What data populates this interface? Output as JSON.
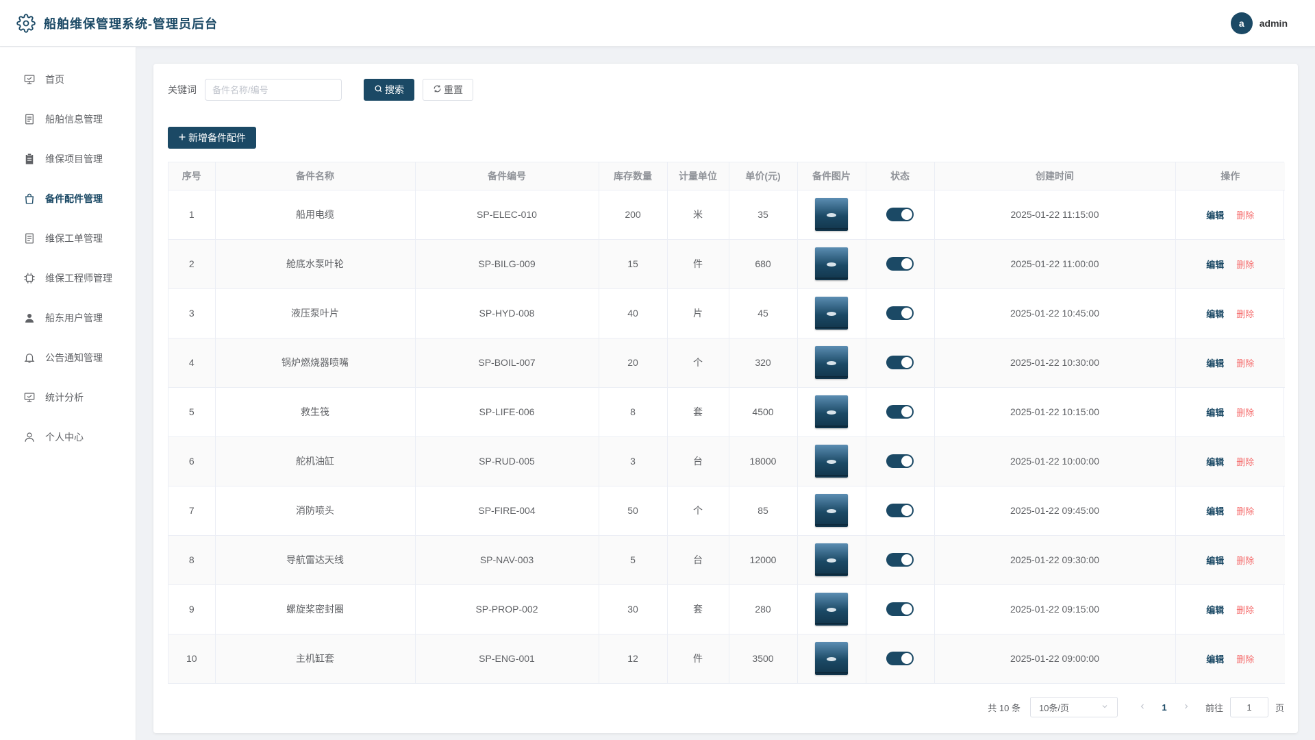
{
  "header": {
    "title": "船舶维保管理系统-管理员后台",
    "avatar_letter": "a",
    "username": "admin"
  },
  "sidebar": {
    "items": [
      {
        "label": "首页",
        "icon": "presentation-icon"
      },
      {
        "label": "船舶信息管理",
        "icon": "document-icon"
      },
      {
        "label": "维保项目管理",
        "icon": "clipboard-icon"
      },
      {
        "label": "备件配件管理",
        "icon": "bag-icon",
        "active": true
      },
      {
        "label": "维保工单管理",
        "icon": "document-icon"
      },
      {
        "label": "维保工程师管理",
        "icon": "cpu-icon"
      },
      {
        "label": "船东用户管理",
        "icon": "user-filled-icon"
      },
      {
        "label": "公告通知管理",
        "icon": "bell-icon"
      },
      {
        "label": "统计分析",
        "icon": "presentation-icon"
      },
      {
        "label": "个人中心",
        "icon": "user-outline-icon"
      }
    ]
  },
  "search": {
    "label": "关键词",
    "placeholder": "备件名称/编号",
    "value": "",
    "search_label": "搜索",
    "reset_label": "重置"
  },
  "add_label": "新增备件配件",
  "table": {
    "headers": [
      "序号",
      "备件名称",
      "备件编号",
      "库存数量",
      "计量单位",
      "单价(元)",
      "备件图片",
      "状态",
      "创建时间",
      "操作"
    ],
    "edit_label": "编辑",
    "delete_label": "删除",
    "rows": [
      {
        "no": "1",
        "name": "船用电缆",
        "code": "SP-ELEC-010",
        "stock": "200",
        "unit": "米",
        "price": "35",
        "status": true,
        "created": "2025-01-22 11:15:00"
      },
      {
        "no": "2",
        "name": "舱底水泵叶轮",
        "code": "SP-BILG-009",
        "stock": "15",
        "unit": "件",
        "price": "680",
        "status": true,
        "created": "2025-01-22 11:00:00"
      },
      {
        "no": "3",
        "name": "液压泵叶片",
        "code": "SP-HYD-008",
        "stock": "40",
        "unit": "片",
        "price": "45",
        "status": true,
        "created": "2025-01-22 10:45:00"
      },
      {
        "no": "4",
        "name": "锅炉燃烧器喷嘴",
        "code": "SP-BOIL-007",
        "stock": "20",
        "unit": "个",
        "price": "320",
        "status": true,
        "created": "2025-01-22 10:30:00"
      },
      {
        "no": "5",
        "name": "救生筏",
        "code": "SP-LIFE-006",
        "stock": "8",
        "unit": "套",
        "price": "4500",
        "status": true,
        "created": "2025-01-22 10:15:00"
      },
      {
        "no": "6",
        "name": "舵机油缸",
        "code": "SP-RUD-005",
        "stock": "3",
        "unit": "台",
        "price": "18000",
        "status": true,
        "created": "2025-01-22 10:00:00"
      },
      {
        "no": "7",
        "name": "消防喷头",
        "code": "SP-FIRE-004",
        "stock": "50",
        "unit": "个",
        "price": "85",
        "status": true,
        "created": "2025-01-22 09:45:00"
      },
      {
        "no": "8",
        "name": "导航雷达天线",
        "code": "SP-NAV-003",
        "stock": "5",
        "unit": "台",
        "price": "12000",
        "status": true,
        "created": "2025-01-22 09:30:00"
      },
      {
        "no": "9",
        "name": "螺旋桨密封圈",
        "code": "SP-PROP-002",
        "stock": "30",
        "unit": "套",
        "price": "280",
        "status": true,
        "created": "2025-01-22 09:15:00"
      },
      {
        "no": "10",
        "name": "主机缸套",
        "code": "SP-ENG-001",
        "stock": "12",
        "unit": "件",
        "price": "3500",
        "status": true,
        "created": "2025-01-22 09:00:00"
      }
    ]
  },
  "pagination": {
    "total_text": "共 10 条",
    "page_size": "10条/页",
    "current_page": "1",
    "goto_label": "前往",
    "goto_value": "1",
    "goto_unit": "页"
  },
  "colors": {
    "primary": "#1b4965",
    "danger": "#f56c6c"
  }
}
